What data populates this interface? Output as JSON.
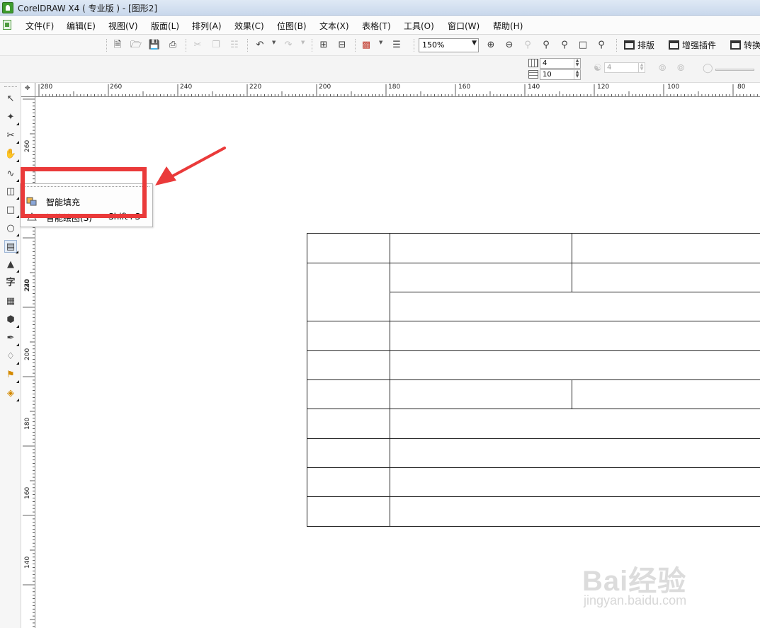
{
  "window": {
    "title": "CorelDRAW X4 ( 专业版 ) - [图形2]"
  },
  "menu": [
    "文件(F)",
    "编辑(E)",
    "视图(V)",
    "版面(L)",
    "排列(A)",
    "效果(C)",
    "位图(B)",
    "文本(X)",
    "表格(T)",
    "工具(O)",
    "窗口(W)",
    "帮助(H)"
  ],
  "toolbar": {
    "zoom_value": "150%",
    "plugins": [
      "排版",
      "增强插件",
      "转换"
    ]
  },
  "property_bar": {
    "columns": "4",
    "rows": "10",
    "dim_value": "4"
  },
  "ruler": {
    "horizontal_labels": [
      "280",
      "260",
      "240",
      "220",
      "200",
      "180",
      "160",
      "140",
      "120",
      "100",
      "80"
    ],
    "vertical_labels": [
      "260",
      "240",
      "220",
      "200",
      "180",
      "160",
      "140"
    ]
  },
  "flyout": {
    "items": [
      {
        "label": "智能填充",
        "shortcut": ""
      },
      {
        "label": "智能绘图(S)",
        "shortcut": "Shift+S"
      }
    ]
  },
  "watermark": {
    "brand": "Bai经验",
    "url": "jingyan.baidu.com"
  },
  "colors": {
    "highlight": "#ea3a3a",
    "title_bar": "#dfe9f5"
  }
}
